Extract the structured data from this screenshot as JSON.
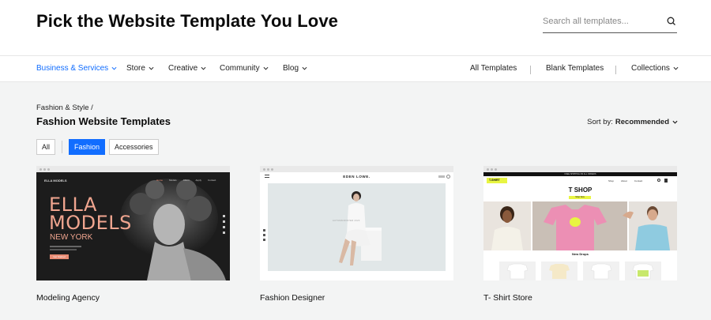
{
  "header": {
    "title": "Pick the Website Template You Love"
  },
  "search": {
    "placeholder": "Search all templates...",
    "icon": "search-icon"
  },
  "nav": {
    "left": [
      {
        "label": "Business & Services",
        "active": true
      },
      {
        "label": "Store"
      },
      {
        "label": "Creative"
      },
      {
        "label": "Community"
      },
      {
        "label": "Blog"
      }
    ],
    "right": [
      {
        "label": "All Templates"
      },
      {
        "label": "Blank Templates"
      },
      {
        "label": "Collections"
      }
    ]
  },
  "breadcrumb": "Fashion & Style /",
  "section_title": "Fashion Website Templates",
  "sort": {
    "label": "Sort by:",
    "value": "Recommended"
  },
  "filters": [
    {
      "label": "All",
      "active": false
    },
    {
      "label": "Fashion",
      "active": true
    },
    {
      "label": "Accessories",
      "active": false
    }
  ],
  "templates": [
    {
      "name": "Modeling Agency",
      "preview": {
        "brand": "ELLA MODELS",
        "headline_1": "ELLA",
        "headline_2": "MODELS",
        "subline": "NEW YORK",
        "nav": [
          "Home",
          "Models",
          "About",
          "Apply",
          "Contact"
        ],
        "cta": "Get Started"
      }
    },
    {
      "name": "Fashion Designer",
      "preview": {
        "brand": "EDEN LOWE.",
        "caption": "AUTUMN/WINTER 2023"
      }
    },
    {
      "name": "T- Shirt Store",
      "preview": {
        "promo": "FREE SHIPPING ON ALL ORDERS",
        "logo": "T-SHIRT",
        "nav": [
          "Shop",
          "About",
          "Contact"
        ],
        "headline": "T SHOP",
        "cta": "Shop Now",
        "section": "New Drops"
      }
    }
  ],
  "colors": {
    "accent": "#116dff",
    "agency_text": "#f0a58f",
    "tshirt_yellow": "#e8f542"
  }
}
